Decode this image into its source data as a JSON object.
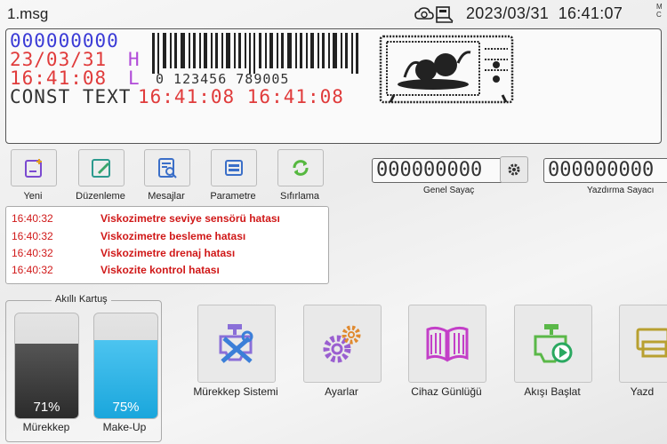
{
  "window": {
    "title": "1.msg",
    "datetime": "2023/03/31  16:41:07",
    "corner": [
      "M",
      "C"
    ]
  },
  "status_icons": [
    "cloud-sync-icon",
    "printer-status-icon"
  ],
  "preview": {
    "line1": "000000000",
    "line2a": "23/03/31",
    "line2b": "H",
    "line3a": "16:41:08",
    "line3b": "L",
    "line4a": "CONST TEXT",
    "line4b": "16:41:08 16:41:08",
    "barcode_text": "0 123456 789005"
  },
  "toolbar": [
    {
      "name": "new",
      "label": "Yeni"
    },
    {
      "name": "edit",
      "label": "Düzenleme"
    },
    {
      "name": "messages",
      "label": "Mesajlar"
    },
    {
      "name": "parameters",
      "label": "Parametre"
    },
    {
      "name": "reset",
      "label": "Sıfırlama"
    }
  ],
  "counters": {
    "general": {
      "value": "000000000",
      "label": "Genel Sayaç"
    },
    "print": {
      "value": "000000000",
      "label": "Yazdırma Sayacı"
    }
  },
  "errors": [
    {
      "time": "16:40:32",
      "message": "Viskozimetre seviye sensörü hatası"
    },
    {
      "time": "16:40:32",
      "message": "Viskozimetre besleme hatası"
    },
    {
      "time": "16:40:32",
      "message": "Viskozimetre drenaj hatası"
    },
    {
      "time": "16:40:32",
      "message": "Viskozite kontrol hatası"
    }
  ],
  "cartridge": {
    "title": "Akıllı Kartuş",
    "ink": {
      "label": "Mürekkep",
      "percent_text": "71%",
      "level": 0.71,
      "color": "#2b2b2b"
    },
    "makeup": {
      "label": "Make-Up",
      "percent_text": "75%",
      "level": 0.75,
      "color": "#1aa6dc"
    }
  },
  "apps": [
    {
      "label": "Mürekkep Sistemi",
      "icon": "ink-system-icon"
    },
    {
      "label": "Ayarlar",
      "icon": "settings-gears-icon"
    },
    {
      "label": "Cihaz Günlüğü",
      "icon": "device-log-book-icon"
    },
    {
      "label": "Akışı Başlat",
      "icon": "start-flow-icon"
    },
    {
      "label": "Yazd",
      "icon": "print-icon"
    }
  ]
}
